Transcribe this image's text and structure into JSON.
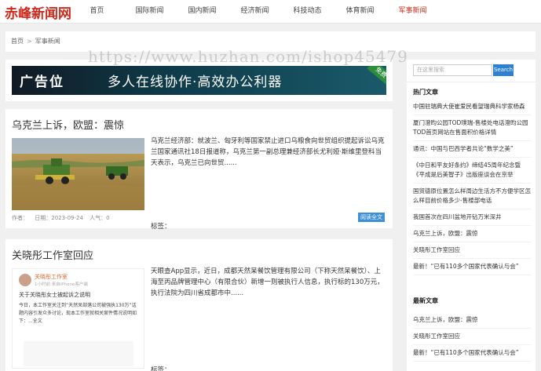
{
  "site": {
    "logo": "赤峰新闻网"
  },
  "nav": [
    "首页",
    "国际新闻",
    "国内新闻",
    "经济新闻",
    "科技动态",
    "体育新闻",
    "军事新闻"
  ],
  "breadcrumb": {
    "home": "首页",
    "sep": ">",
    "current": "军事新闻"
  },
  "watermark": "https://www.huzhan.com/ishop45479",
  "ad": {
    "tag": "广告位",
    "slogan": "多人在线协作·高效办公利器",
    "corner": "免费"
  },
  "articles": [
    {
      "title": "乌克兰上诉，欧盟：震惊",
      "summary": "乌克兰经济部：就波兰、匈牙利等国家禁止进口乌粮食向世贸组织提起诉讼乌克兰国家通讯社18日报道称，乌克兰第一副总理兼经济部长尤利娅·斯维里登科当天表示，乌克兰已向世贸......",
      "tags": "标签：",
      "meta": {
        "author": "作者：",
        "date": "日期：2023-09-24",
        "views": "人气：0"
      },
      "button": "阅读全文"
    },
    {
      "title": "关晓彤工作室回应",
      "summary": "天眼查App显示，近日，成都天然呆餐饮管理有限公司（下称天然呆餐饮）、上海至丙品牌管理中心（有限合伙）新增一则被执行人信息，执行标的130万元，执行法院为四川省成都市中......",
      "tags": "标签：",
      "thumb": {
        "name": "关晓彤工作室",
        "handle": "1小时前 来自iPhone客户端",
        "headline": "关于关晓彤女士被起诉之说明",
        "body": "今日，本工作室关注到“天然呆部落公司被强执130万”话题内容引发众多讨论，现本工作室就相关案件情况说明如下：...全文"
      }
    }
  ],
  "sidebar": {
    "search_placeholder": "在这里搜索",
    "search_button": "Search",
    "hot_title": "热门文章",
    "hot": [
      "中国驻瑞典大使崔爱民看望瑞典科学家杨森",
      "厦门澄昀公园TOD璞瑞-售楼处电话澄昀公园TOD首页网站在售面积价格详情",
      "通讯：中国与巴西学者共论“数学之美”",
      "《中日和平友好条约》缔结45周年纪念暨《平成是后美智子》出版座谈会在京举",
      "国贸德原位置怎么样周边生活方不方便学区怎么样目前价格多少-售楼部电话",
      "我国首次在四川盆地开钻万米深井",
      "乌克兰上诉，欧盟：震惊",
      "关晓彤工作室回应",
      "最新！“已有110多个国家代表确认与会”"
    ],
    "latest_title": "最新文章",
    "latest": [
      "乌克兰上诉，欧盟：震惊",
      "关晓彤工作室回应",
      "最新！“已有110多个国家代表确认与会”"
    ]
  },
  "colors": {
    "brand": "#cc2a1c",
    "button": "#3d8fd6"
  }
}
